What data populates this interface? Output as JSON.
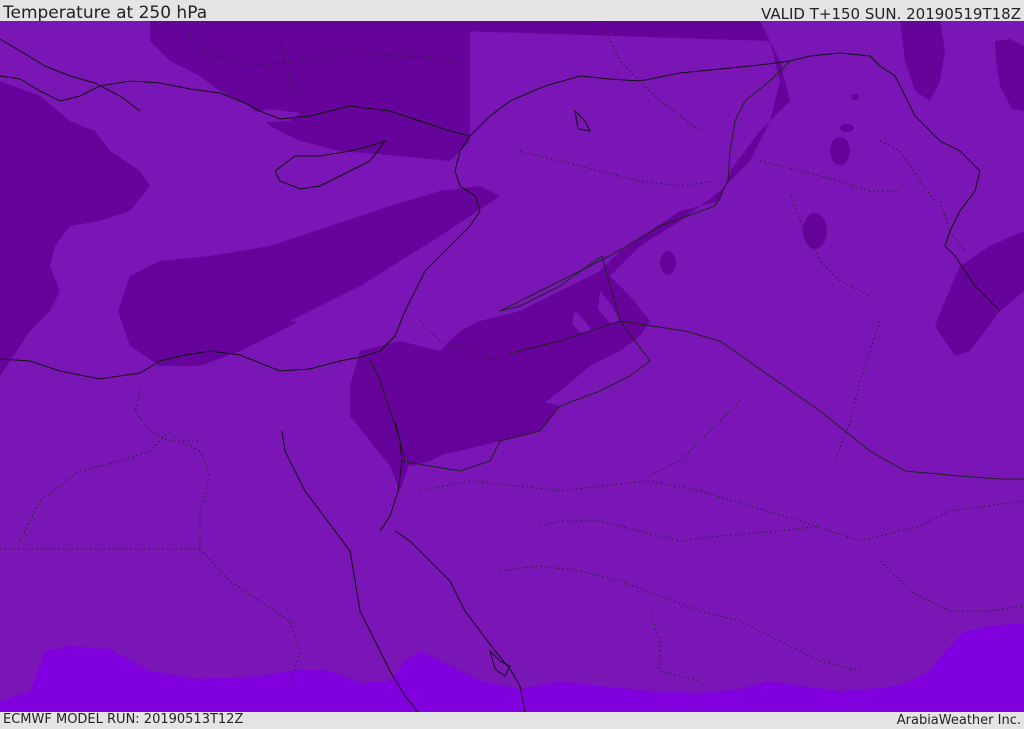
{
  "header": {
    "title": "Temperature at 250 hPa",
    "valid_time": "VALID T+150 SUN. 20190519T18Z"
  },
  "footer": {
    "model_run": "ECMWF MODEL RUN: 20190513T12Z",
    "credit": "ArabiaWeather Inc."
  },
  "map": {
    "field": "temperature-250hPa",
    "colors": {
      "base": "#7a16b6",
      "colder": "#66039a",
      "warm_band": "#8100de",
      "coast_line": "#111111",
      "border_line": "#222222"
    }
  }
}
